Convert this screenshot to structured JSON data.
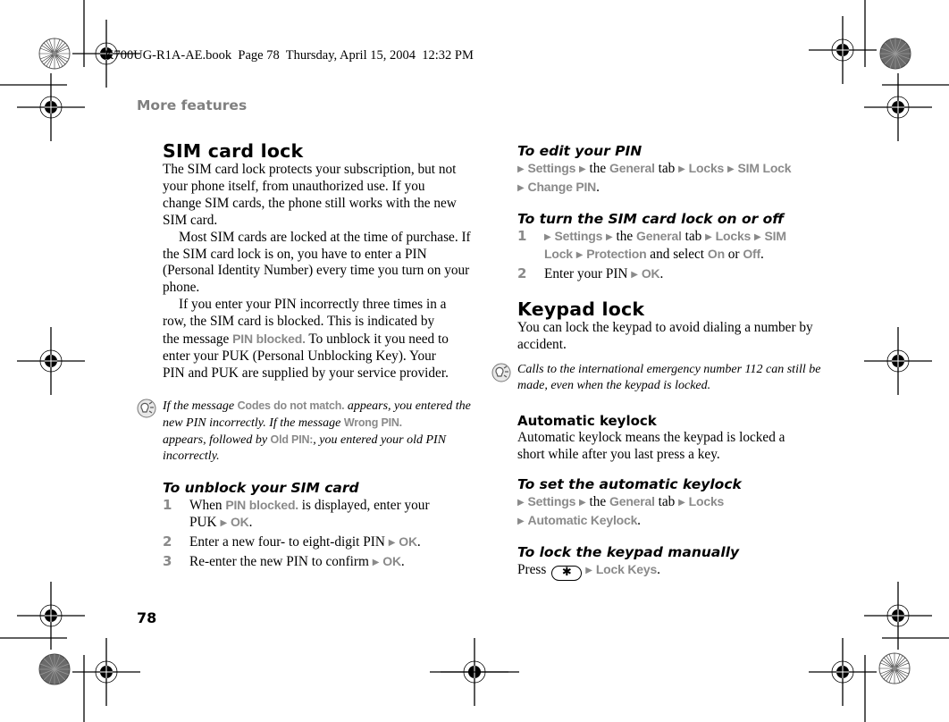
{
  "book_header": "K700UG-R1A-AE.book  Page 78  Thursday, April 15, 2004  12:32 PM",
  "section_title": "More features",
  "page_number": "78",
  "icons": {
    "note": "lightbulb-note-icon",
    "arrow": "▶",
    "star_key": "✱"
  },
  "colors": {
    "ui_text": "#8a8a8a",
    "section_title": "#808080"
  },
  "left": {
    "sim_lock": {
      "title": "SIM card lock",
      "para1": "The SIM card lock protects your subscription, but not your phone itself, from unauthorized use. If you change SIM cards, the phone still works with the new SIM card.",
      "para2": "Most SIM cards are locked at the time of purchase. If the SIM card lock is on, you have to enter a PIN (Personal Identity Number) every time you turn on your phone.",
      "para3_a": "If you enter your PIN incorrectly three times in a row, the SIM card is blocked. This is indicated by the message ",
      "para3_ui": "PIN blocked.",
      "para3_b": " To unblock it you need to enter your PUK (Personal Unblocking Key). Your PIN and PUK are supplied by your service provider."
    },
    "note": {
      "t1": "If the message ",
      "ui1": "Codes do not match.",
      "t2": " appears, you entered the new PIN incorrectly. If the message ",
      "ui2": "Wrong PIN.",
      "t3": " appears, followed by ",
      "ui3": "Old PIN:",
      "t4": ", you entered your old PIN incorrectly."
    },
    "unblock": {
      "title": "To unblock your SIM card",
      "steps": [
        {
          "num": "1",
          "a": "When ",
          "ui": "PIN blocked.",
          "b": " is displayed, enter your PUK ",
          "ok": "OK",
          "end": "."
        },
        {
          "num": "2",
          "a": "Enter a new four- to eight-digit PIN ",
          "ok": "OK",
          "end": "."
        },
        {
          "num": "3",
          "a": "Re-enter the new PIN to confirm ",
          "ok": "OK",
          "end": "."
        }
      ]
    }
  },
  "right": {
    "edit_pin": {
      "title": "To edit your PIN",
      "settings": "Settings",
      "the": " the ",
      "general": "General",
      "tab": " tab ",
      "locks": "Locks",
      "sim_lock": "SIM Lock",
      "change_pin": "Change PIN",
      "end": "."
    },
    "turn_lock": {
      "title": "To turn the SIM card lock on or off",
      "step1_num": "1",
      "settings": "Settings",
      "the": " the ",
      "general": "General",
      "tab": " tab ",
      "locks": "Locks",
      "sim_lock_a": "SIM",
      "sim_lock_b": "Lock",
      "protection": "Protection",
      "and_select": " and select ",
      "on": "On",
      "or": " or ",
      "off": "Off",
      "end": ".",
      "step2_num": "2",
      "step2_text": "Enter your PIN ",
      "ok": "OK"
    },
    "keypad_lock": {
      "title": "Keypad lock",
      "para": "You can lock the keypad to avoid dialing a number by accident."
    },
    "note": {
      "text": "Calls to the international emergency number 112 can still be made, even when the keypad is locked."
    },
    "auto_keylock": {
      "title": "Automatic keylock",
      "para": "Automatic keylock means the keypad is locked a short while after you last press a key."
    },
    "set_auto": {
      "title": "To set the automatic keylock",
      "settings": "Settings",
      "the": " the ",
      "general": "General",
      "tab": " tab ",
      "locks": "Locks",
      "auto_keylock": "Automatic Keylock",
      "end": "."
    },
    "manual": {
      "title": "To lock the keypad manually",
      "press": "Press",
      "lock_keys": "Lock Keys",
      "end": "."
    }
  }
}
